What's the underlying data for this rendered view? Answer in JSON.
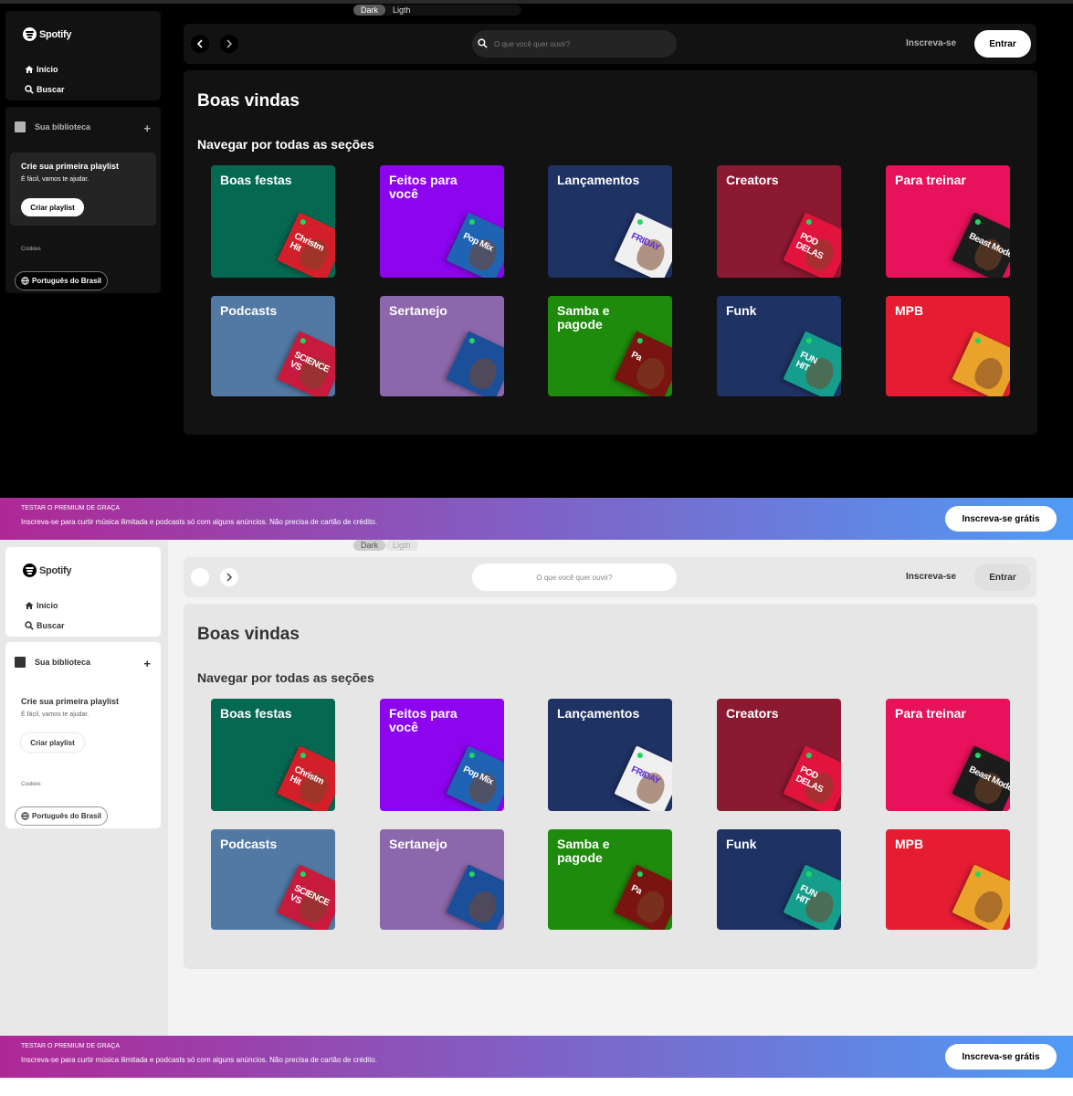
{
  "theme_toggle": {
    "dark_label": "Dark",
    "light_label": "Ligth"
  },
  "sidebar": {
    "logo": "Spotify",
    "home": "Início",
    "search": "Buscar"
  },
  "library": {
    "title": "Sua biblioteca",
    "create_title": "Crie sua primeira playlist",
    "create_subtitle": "É fácil, vamos te ajudar.",
    "create_button": "Criar playlist",
    "cookies": "Cookies",
    "language": "Português do Brasil"
  },
  "topbar": {
    "search_placeholder": "O que você quer ouvir?",
    "signup": "Inscreva-se",
    "login": "Entrar"
  },
  "main": {
    "welcome": "Boas vindas",
    "browse_heading": "Navegar por todas as seções"
  },
  "categories": [
    {
      "label": "Boas festas",
      "color": "#056952",
      "art_color": "#d21f2a",
      "art_text": "Christm\nHit"
    },
    {
      "label": "Feitos para você",
      "color": "#8d04ef",
      "art_color": "#1e63b4",
      "art_text": "Pop Mix"
    },
    {
      "label": "Lançamentos",
      "color": "#1e3264",
      "art_color": "#f0f0f0",
      "art_text": "FRIDAY"
    },
    {
      "label": "Creators",
      "color": "#8c1932",
      "art_color": "#e0143c",
      "art_text": "POD\nDELAS"
    },
    {
      "label": "Para treinar",
      "color": "#e8115b",
      "art_color": "#1c1c1c",
      "art_text": "Beast Mode"
    },
    {
      "label": "Podcasts",
      "color": "#5279a4",
      "art_color": "#c71a3c",
      "art_text": "SCIENCE\nVS"
    },
    {
      "label": "Sertanejo",
      "color": "#8d67ab",
      "art_color": "#1b4f9a",
      "art_text": ""
    },
    {
      "label": "Samba e pagode",
      "color": "#1e8b0c",
      "art_color": "#7a1410",
      "art_text": "Pa"
    },
    {
      "label": "Funk",
      "color": "#1e3264",
      "art_color": "#159e8c",
      "art_text": "FUN\nHIT"
    },
    {
      "label": "MPB",
      "color": "#e61d32",
      "art_color": "#e9a22a",
      "art_text": ""
    }
  ],
  "promo": {
    "eyebrow": "TESTAR O PREMIUM DE GRAÇA",
    "text": "Inscreva-se para curtir música ilimitada e podcasts só com alguns anúncios. Não precisa de cartão de crédito.",
    "button": "Inscreva-se grátis"
  }
}
